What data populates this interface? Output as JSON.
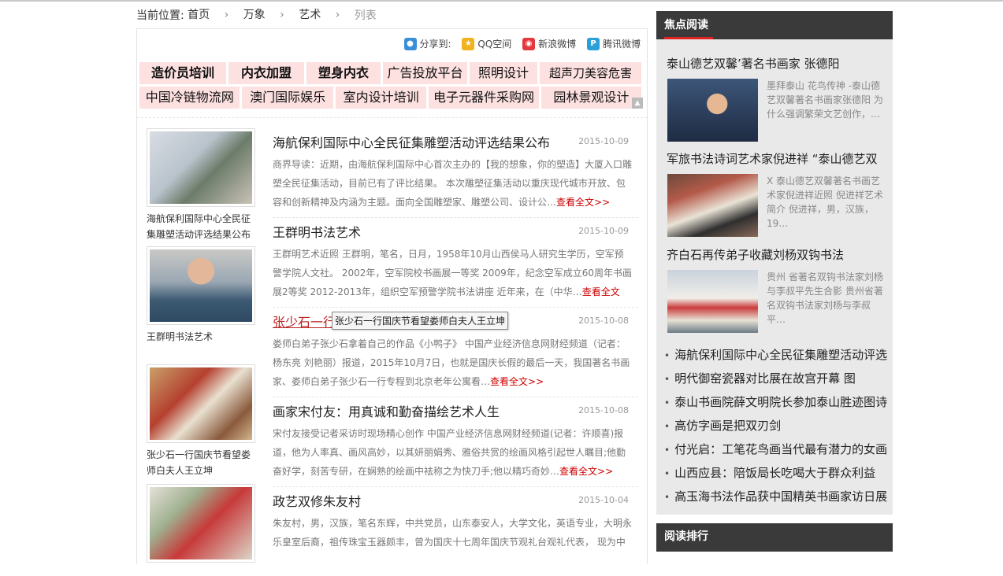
{
  "breadcrumb": {
    "label": "当前位置:",
    "items": [
      "首页",
      "万象",
      "艺术",
      "列表"
    ]
  },
  "share": {
    "label": "分享到:",
    "targets": [
      "QQ空间",
      "新浪微博",
      "腾讯微博"
    ]
  },
  "ads": {
    "row1": [
      "造价员培训",
      "内衣加盟",
      "塑身内衣",
      "广告投放平台",
      "照明设计",
      "超声刀美容危害"
    ],
    "row2": [
      "中国冷链物流网",
      "澳门国际娱乐",
      "室内设计培训",
      "电子元器件采购网",
      "园林景观设计"
    ]
  },
  "thumbs": [
    {
      "caption": "海航保利国际中心全民征集雕塑活动评选结果公布"
    },
    {
      "caption": "王群明书法艺术"
    },
    {
      "caption": "张少石一行国庆节看望娄师白夫人王立坤"
    },
    {
      "caption": ""
    }
  ],
  "articles": [
    {
      "title": "海航保利国际中心全民征集雕塑活动评选结果公布",
      "date": "2015-10-09",
      "summary": "商界导读：近期，由海航保利国际中心首次主办的【我的想象，你的塑造】大厦入口雕塑全民征集活动，目前已有了评比结果。 本次雕塑征集活动以重庆现代城市开放、包容和创新精神及内涵为主题。面向全国雕塑家、雕塑公司、设计公…",
      "more": "查看全文>>"
    },
    {
      "title": "王群明书法艺术",
      "date": "2015-10-09",
      "summary": "王群明艺术近照 王群明，笔名，日月，1958年10月山西侯马人研究生学历，空军预警学院人文社。 2002年，空军院校书画展一等奖 2009年，纪念空军成立60周年书画展2等奖 2012-2013年，组织空军预警学院书法讲座 近年来，在（中华…",
      "more": "查看全文>>"
    },
    {
      "title": "张少石一行国庆节看望娄师白夫人王立坤",
      "date": "2015-10-08",
      "summary": "娄师白弟子张少石拿着自己的作品《小鸭子》 中国产业经济信息网财经频道（记者：杨东亮 刘艳丽）报道，2015年10月7日，也就是国庆长假的最后一天，我国著名书画家、娄师白弟子张少石一行专程到北京老年公寓看…",
      "more": "查看全文>>"
    },
    {
      "title": "画家宋付友：用真诚和勤奋描绘艺术人生",
      "date": "2015-10-08",
      "summary": "宋付友接受记者采访时现场精心创作 中国产业经济信息网财经频道(记者：许顺喜)报道，他为人率真、画风高妙，以其妍丽娟秀、雅俗共赏的绘画风格引起世人瞩目;他勤奋好学，刻苦专研，在娴熟的绘画中袪称之为快刀手;他以精巧奇妙…",
      "more": "查看全文>>"
    },
    {
      "title": "政艺双修朱友村",
      "date": "2015-10-04",
      "summary": "朱友村，男，汉族，笔名东辉，中共党员，山东泰安人，大学文化，英语专业，大明永乐皇室后裔，祖传珠宝玉器颇丰，曾为国庆十七周年国庆节观礼台观礼代表， 现为中",
      "more": ""
    }
  ],
  "tooltip": "张少石一行国庆节看望娄师白夫人王立坤",
  "sidebar": {
    "title": "焦点阅读",
    "features": [
      {
        "title": "泰山德艺双馨’著名书画家 张德阳",
        "desc": "墨拜泰山 花鸟传神 -泰山德艺双馨著名书画家张德阳 为什么强调繁荣文艺创作，…"
      },
      {
        "title": "军旅书法诗词艺术家倪进祥 “泰山德艺双",
        "desc": "X 泰山德艺双馨著名书画艺术家倪进祥近照 倪进祥艺术简介 倪进祥，男，汉族，19…"
      },
      {
        "title": "齐白石再传弟子收藏刘杨双钩书法",
        "desc": "贵州 省著名双钩书法家刘杨与李叔平先生合影 贵州省著名双钩书法家刘杨与李叔平…"
      }
    ],
    "list": [
      "海航保利国际中心全民征集雕塑活动评选",
      "明代御窑瓷器对比展在故宫开幕 图",
      "泰山书画院薛文明院长参加泰山胜迹图诗",
      "高仿字画是把双刃剑",
      "付光启：工笔花鸟画当代最有潜力的女画",
      "山西应县：陪饭局长吃喝大于群众利益",
      "高玉海书法作品获中国精英书画家访日展"
    ],
    "ranking_title": "阅读排行"
  }
}
